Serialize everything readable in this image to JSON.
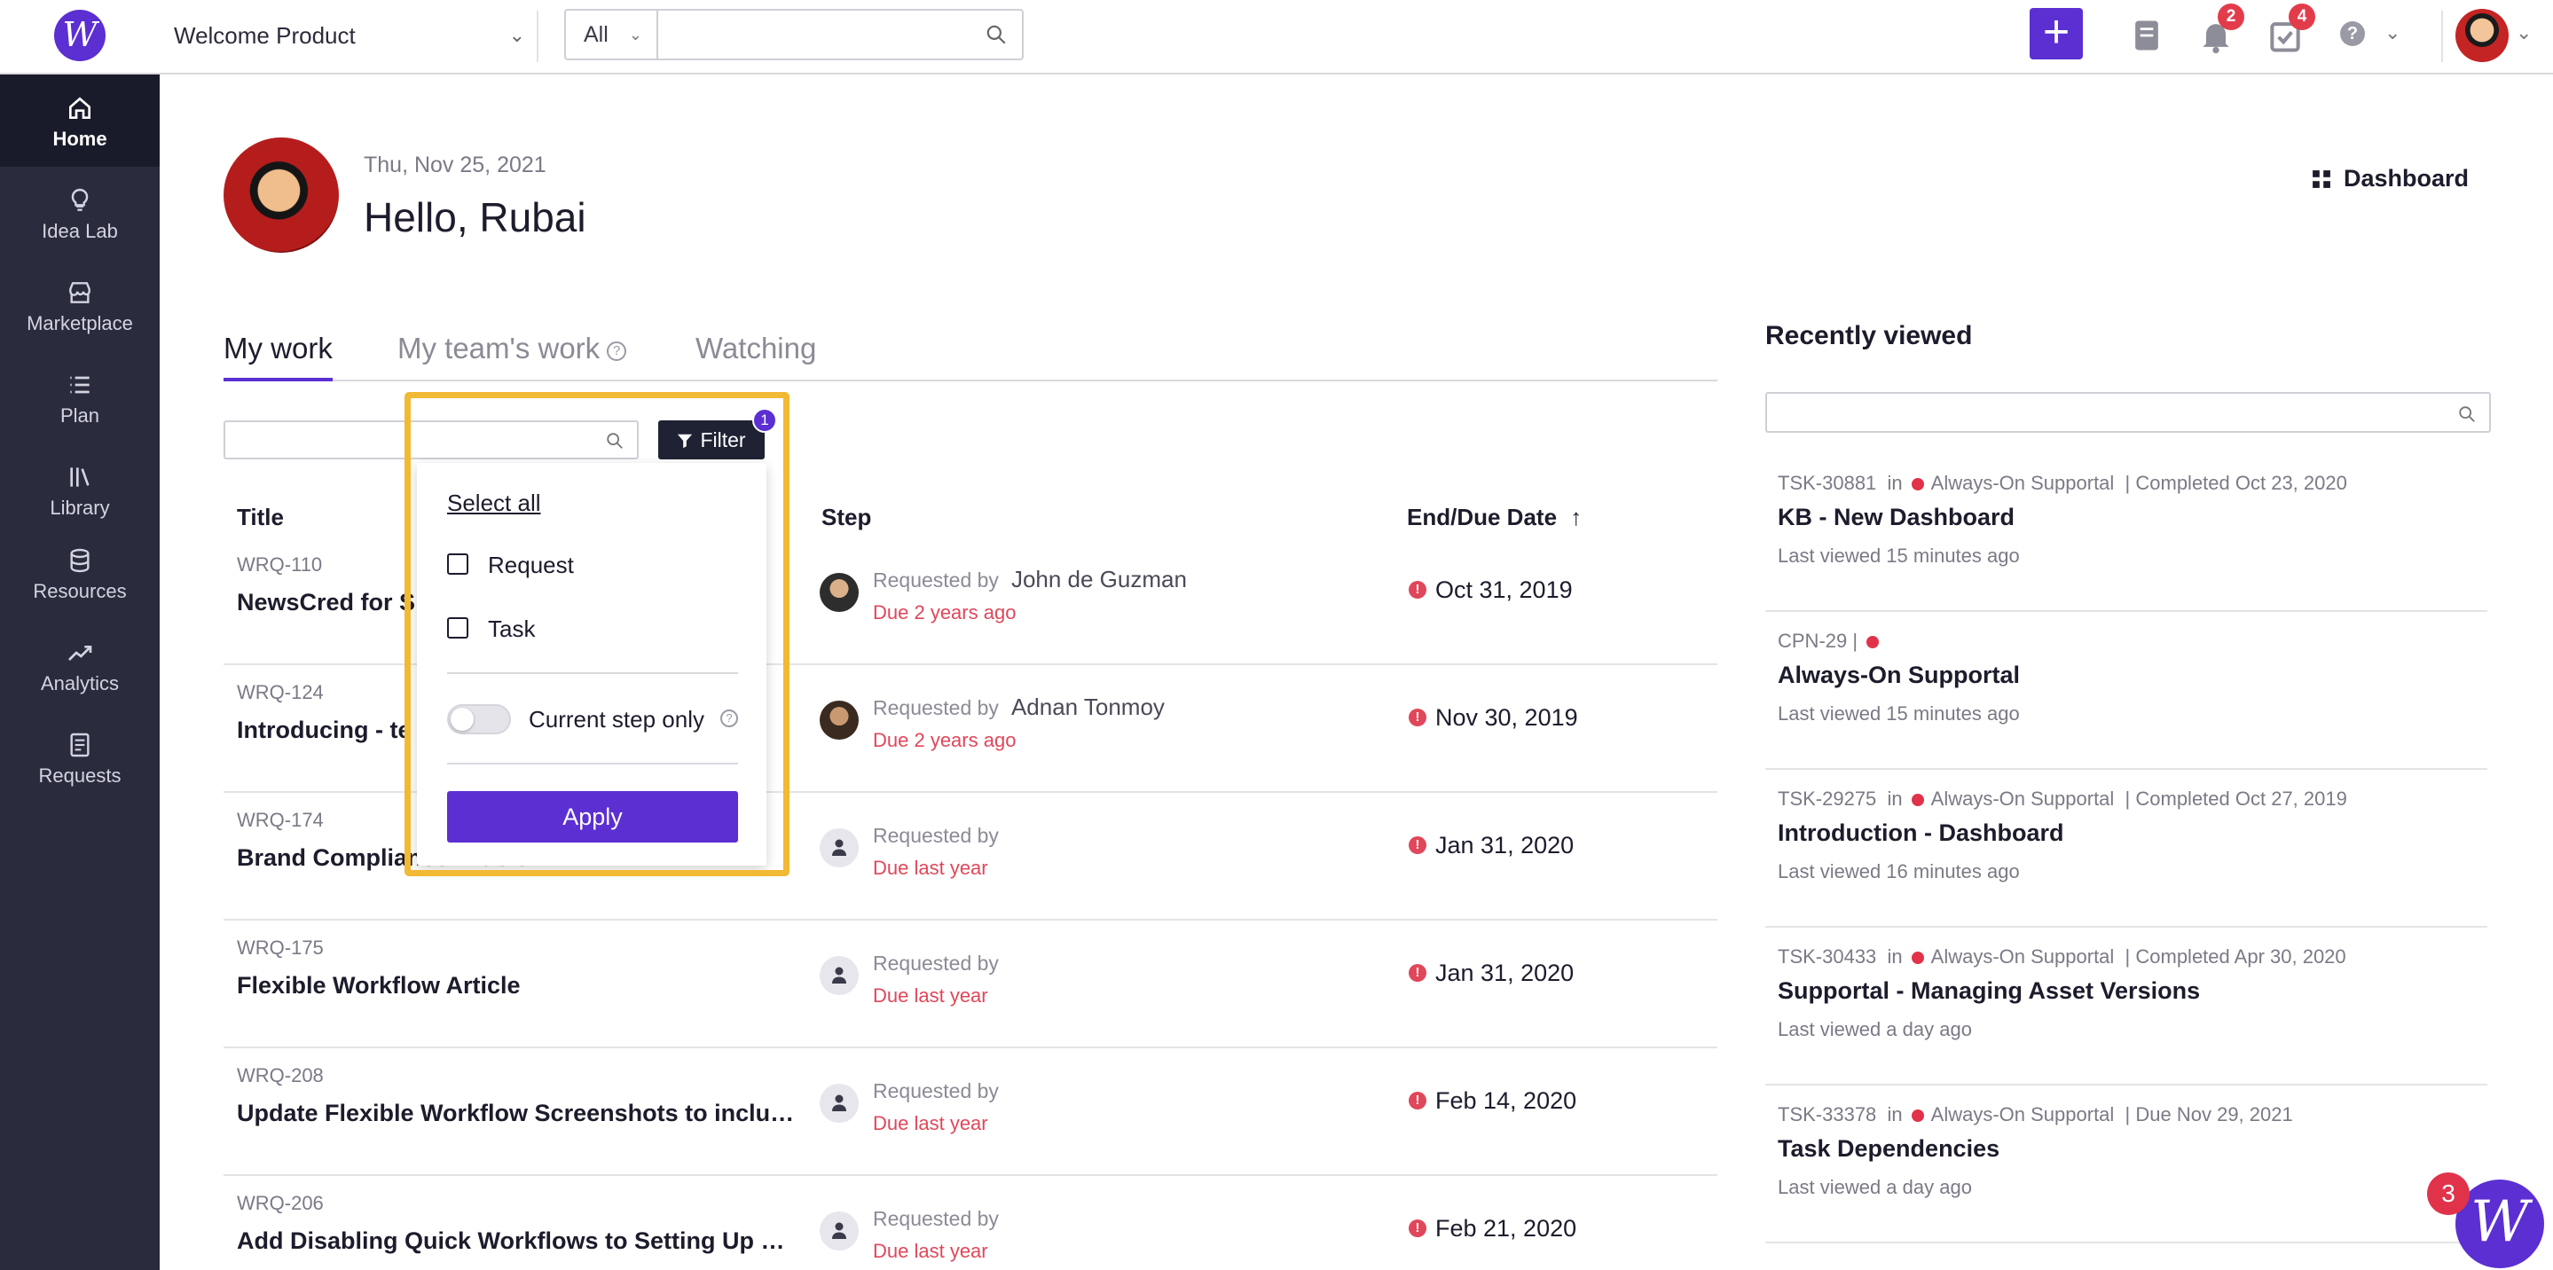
{
  "topbar": {
    "logo": "W",
    "product": "Welcome Product",
    "search_scope": "All",
    "search_placeholder": "",
    "notifications_count": "2",
    "tasks_count": "4",
    "help": "?"
  },
  "sidebar": {
    "items": [
      {
        "label": "Home",
        "icon": "home-icon"
      },
      {
        "label": "Idea Lab",
        "icon": "lightbulb-icon"
      },
      {
        "label": "Marketplace",
        "icon": "store-icon"
      },
      {
        "label": "Plan",
        "icon": "list-icon"
      },
      {
        "label": "Library",
        "icon": "library-icon"
      },
      {
        "label": "Resources",
        "icon": "database-icon"
      },
      {
        "label": "Analytics",
        "icon": "trend-icon"
      },
      {
        "label": "Requests",
        "icon": "document-icon"
      }
    ]
  },
  "greeting": {
    "date": "Thu, Nov 25, 2021",
    "hello": "Hello, Rubai",
    "dashboard_label": "Dashboard"
  },
  "tabs": [
    {
      "label": "My work"
    },
    {
      "label": "My team's work"
    },
    {
      "label": "Watching"
    }
  ],
  "filter": {
    "button_label": "Filter",
    "badge": "1",
    "select_all": "Select all",
    "options": [
      "Request",
      "Task"
    ],
    "toggle_label": "Current step only",
    "apply_label": "Apply"
  },
  "table": {
    "headers": {
      "title": "Title",
      "step": "Step",
      "due": "End/Due Date",
      "sort_icon": "↑"
    },
    "rows": [
      {
        "id": "WRQ-110",
        "title": "NewsCred for S",
        "requested_by_label": "Requested by",
        "requester": "John de Guzman",
        "due": "Due 2 years ago",
        "date": "Oct 31, 2019"
      },
      {
        "id": "WRQ-124",
        "title": "Introducing - te",
        "requested_by_label": "Requested by",
        "requester": "Adnan Tonmoy",
        "due": "Due 2 years ago",
        "date": "Nov 30, 2019"
      },
      {
        "id": "WRQ-174",
        "title": "Brand Compliance Article",
        "requested_by_label": "Requested by",
        "requester": "",
        "due": "Due last year",
        "date": "Jan 31, 2020"
      },
      {
        "id": "WRQ-175",
        "title": "Flexible Workflow Article",
        "requested_by_label": "Requested by",
        "requester": "",
        "due": "Due last year",
        "date": "Jan 31, 2020"
      },
      {
        "id": "WRQ-208",
        "title": "Update Flexible Workflow Screenshots to include fl...",
        "requested_by_label": "Requested by",
        "requester": "",
        "due": "Due last year",
        "date": "Feb 14, 2020"
      },
      {
        "id": "WRQ-206",
        "title": "Add Disabling Quick Workflows to Setting Up Work...",
        "requested_by_label": "Requested by",
        "requester": "",
        "due": "Due last year",
        "date": "Feb 21, 2020"
      }
    ]
  },
  "recently_viewed": {
    "title": "Recently viewed",
    "items": [
      {
        "meta_id": "TSK-30881",
        "meta_in": "in",
        "meta_project": "Always-On Supportal",
        "meta_status": "|  Completed Oct 23, 2020",
        "name": "KB - New Dashboard",
        "viewed": "Last viewed 15 minutes ago"
      },
      {
        "meta_id": "CPN-29  |",
        "meta_in": "",
        "meta_project": "",
        "meta_status": "",
        "name": "Always-On Supportal",
        "viewed": "Last viewed 15 minutes ago"
      },
      {
        "meta_id": "TSK-29275",
        "meta_in": "in",
        "meta_project": "Always-On Supportal",
        "meta_status": "|  Completed Oct 27, 2019",
        "name": "Introduction - Dashboard",
        "viewed": "Last viewed 16 minutes ago"
      },
      {
        "meta_id": "TSK-30433",
        "meta_in": "in",
        "meta_project": "Always-On Supportal",
        "meta_status": "|  Completed Apr 30, 2020",
        "name": "Supportal - Managing Asset Versions",
        "viewed": "Last viewed a day ago"
      },
      {
        "meta_id": "TSK-33378",
        "meta_in": "in",
        "meta_project": "Always-On Supportal",
        "meta_status": "|  Due Nov 29, 2021",
        "name": "Task Dependencies",
        "viewed": "Last viewed a day ago"
      }
    ]
  },
  "chat": {
    "logo": "W",
    "badge": "3"
  },
  "colors": {
    "accent": "#5b2fd2",
    "sidebar": "#2a2b3d",
    "highlight": "#f2b934",
    "overdue": "#e0475a"
  }
}
